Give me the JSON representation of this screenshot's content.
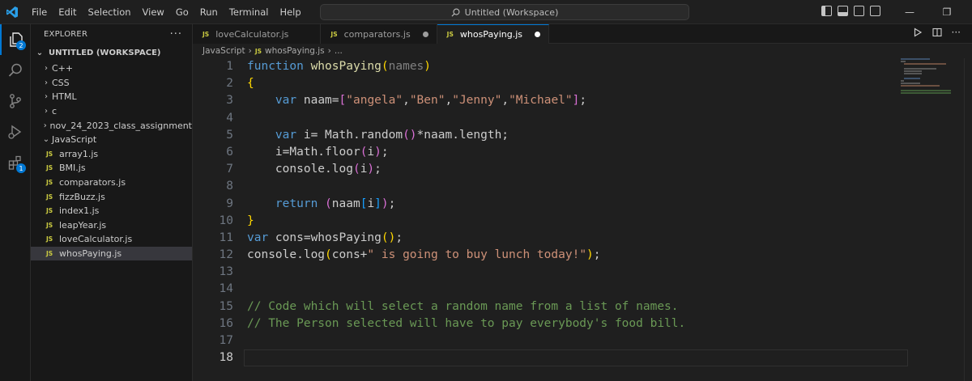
{
  "menu": [
    "File",
    "Edit",
    "Selection",
    "View",
    "Go",
    "Run",
    "Terminal",
    "Help"
  ],
  "command_center": "Untitled (Workspace)",
  "activity": {
    "explorer_badge": "2",
    "extensions_badge": "1"
  },
  "sidebar": {
    "title": "EXPLORER",
    "workspace": "UNTITLED (WORKSPACE)",
    "folders": [
      "C++",
      "CSS",
      "HTML",
      "c",
      "nov_24_2023_class_assignment",
      "JavaScript"
    ],
    "files": [
      "array1.js",
      "BMI.js",
      "comparators.js",
      "fizzBuzz.js",
      "index1.js",
      "leapYear.js",
      "loveCalculator.js",
      "whosPaying.js"
    ],
    "file_badge": "JS"
  },
  "tabs": [
    {
      "label": "loveCalculator.js",
      "modified": false,
      "active": false
    },
    {
      "label": "comparators.js",
      "modified": true,
      "active": false
    },
    {
      "label": "whosPaying.js",
      "modified": true,
      "active": true
    }
  ],
  "breadcrumb": {
    "folder": "JavaScript",
    "file": "whosPaying.js",
    "more": "..."
  },
  "editor": {
    "line_numbers": [
      "1",
      "2",
      "3",
      "4",
      "5",
      "6",
      "7",
      "8",
      "9",
      "10",
      "11",
      "12",
      "13",
      "14",
      "15",
      "16",
      "17",
      "18"
    ],
    "current_line": 18
  },
  "colors": {
    "accent": "#0078d4",
    "keyword": "#569cd6",
    "function": "#dcdcaa",
    "string": "#ce9178",
    "comment": "#6a9955"
  }
}
